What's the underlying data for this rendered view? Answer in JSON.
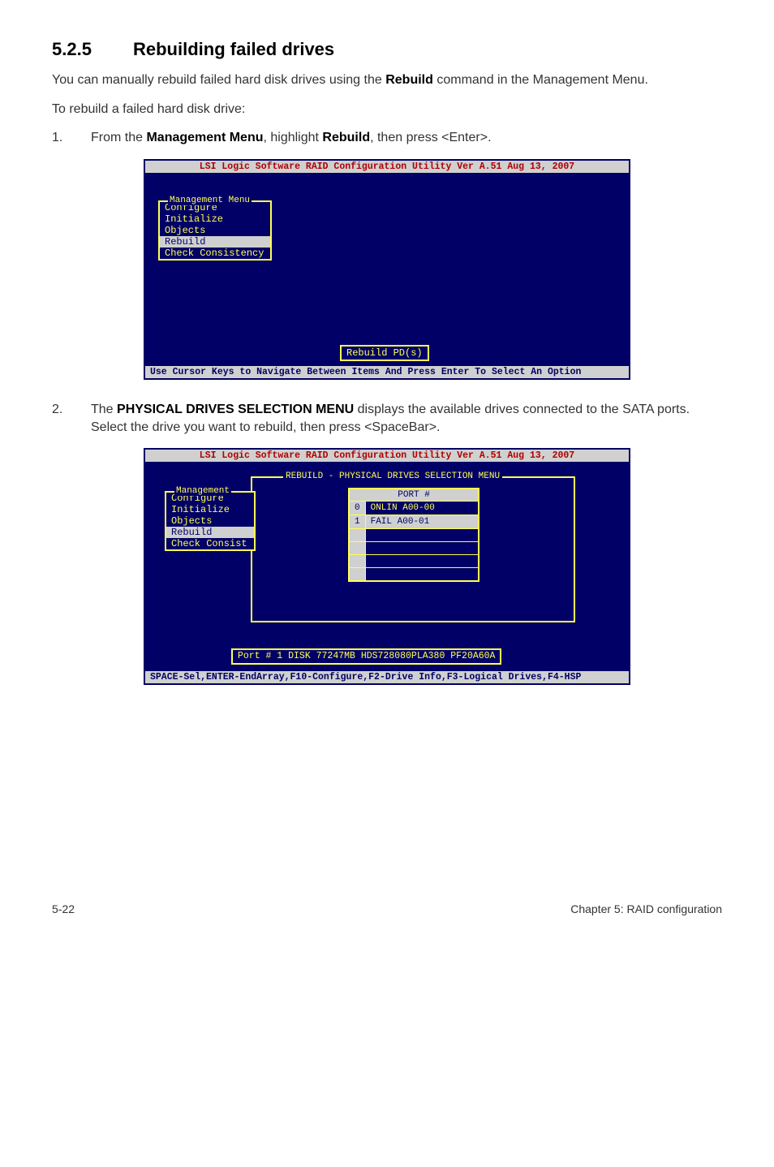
{
  "heading": {
    "num": "5.2.5",
    "title": "Rebuilding failed drives"
  },
  "intro": {
    "p1a": "You can manually rebuild failed hard disk drives using the ",
    "p1b": "Rebuild",
    "p1c": " command in the Management Menu.",
    "p2": "To rebuild a failed hard disk drive:"
  },
  "step1": {
    "num": "1.",
    "a": "From the ",
    "b": "Management Menu",
    "c": ", highlight ",
    "d": "Rebuild",
    "e": ", then press <Enter>."
  },
  "step2": {
    "num": "2.",
    "a": "The ",
    "b": "PHYSICAL DRIVES SELECTION MENU",
    "c": " displays the available drives connected to the SATA ports. Select the drive you want to rebuild, then press <SpaceBar>."
  },
  "bios1": {
    "title": "LSI Logic Software RAID Configuration Utility Ver A.51 Aug 13, 2007",
    "menu_title": "Management Menu",
    "items": {
      "configure": "Configure",
      "initialize": "Initialize",
      "objects": "Objects",
      "rebuild": "Rebuild",
      "check": "Check Consistency"
    },
    "hint": "Rebuild PD(s)",
    "status": "Use Cursor Keys to Navigate Between Items And Press Enter To Select An Option"
  },
  "bios2": {
    "title": "LSI Logic Software RAID Configuration Utility Ver A.51 Aug 13, 2007",
    "section": "REBUILD - PHYSICAL DRIVES SELECTION MENU",
    "menu_title": "Management",
    "items": {
      "configure": "Configure",
      "initialize": "Initialize",
      "objects": "Objects",
      "rebuild": "Rebuild",
      "check": "Check Consist"
    },
    "port_header": "PORT #",
    "rows": {
      "r0_idx": "0",
      "r0_val": "ONLIN A00-00",
      "r1_idx": "1",
      "r1_val": "FAIL  A00-01"
    },
    "info": "Port # 1 DISK   77247MB   HDS728080PLA380   PF20A60A",
    "status": "SPACE-Sel,ENTER-EndArray,F10-Configure,F2-Drive Info,F3-Logical Drives,F4-HSP"
  },
  "footer": {
    "left": "5-22",
    "right": "Chapter 5: RAID configuration"
  }
}
